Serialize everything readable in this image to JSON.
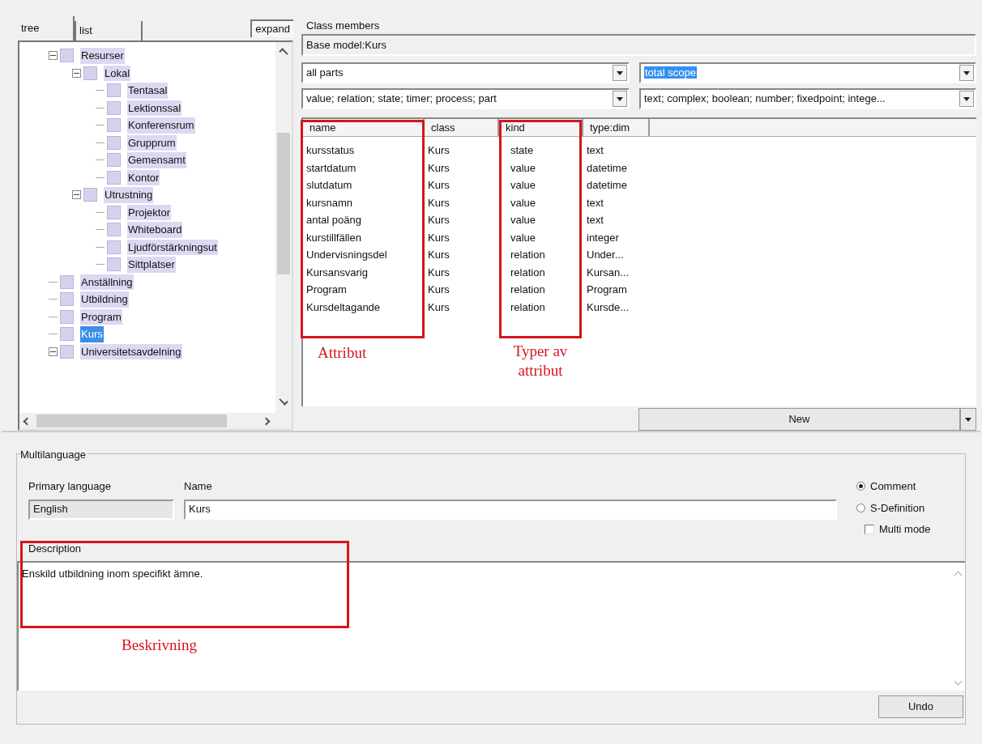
{
  "left_panel": {
    "tabs": [
      {
        "label": "tree",
        "selected": true
      },
      {
        "label": "list",
        "selected": false
      }
    ],
    "expand_button": "expand",
    "tree": [
      {
        "label": "Resurser",
        "selected": false,
        "expanded": true,
        "children": [
          {
            "label": "Lokal",
            "selected": false,
            "expanded": true,
            "children": [
              {
                "label": "Tentasal",
                "selected": false
              },
              {
                "label": "Lektionssal",
                "selected": false
              },
              {
                "label": "Konferensrum",
                "selected": false
              },
              {
                "label": "Grupprum",
                "selected": false
              },
              {
                "label": "Gemensamt",
                "selected": false
              },
              {
                "label": "Kontor",
                "selected": false
              }
            ]
          },
          {
            "label": "Utrustning",
            "selected": false,
            "expanded": true,
            "children": [
              {
                "label": "Projektor",
                "selected": false
              },
              {
                "label": "Whiteboard",
                "selected": false
              },
              {
                "label": "Ljudförstärkningsut",
                "selected": false
              },
              {
                "label": "Sittplatser",
                "selected": false
              }
            ]
          }
        ]
      },
      {
        "label": "Anställning",
        "selected": false
      },
      {
        "label": "Utbildning",
        "selected": false
      },
      {
        "label": "Program",
        "selected": false
      },
      {
        "label": "Kurs",
        "selected": true
      },
      {
        "label": "Universitetsavdelning",
        "selected": false,
        "expanded": true
      }
    ]
  },
  "class_members": {
    "title": "Class members",
    "base_model": "Base model:Kurs",
    "filters": [
      {
        "value": "all parts",
        "text_selected": false
      },
      {
        "value": "total scope",
        "text_selected": true
      },
      {
        "value": "value; relation; state; timer; process; part",
        "text_selected": false
      },
      {
        "value": "text; complex; boolean; number; fixedpoint; intege...",
        "text_selected": false
      }
    ],
    "table": {
      "columns": [
        "name",
        "class",
        "kind",
        "type:dim"
      ],
      "rows": [
        [
          "kursstatus",
          "Kurs",
          "state",
          "text"
        ],
        [
          "startdatum",
          "Kurs",
          "value",
          "datetime"
        ],
        [
          "slutdatum",
          "Kurs",
          "value",
          "datetime"
        ],
        [
          "kursnamn",
          "Kurs",
          "value",
          "text"
        ],
        [
          "antal poäng",
          "Kurs",
          "value",
          "text"
        ],
        [
          "kurstillfällen",
          "Kurs",
          "value",
          "integer"
        ],
        [
          "Undervisningsdel",
          "Kurs",
          "relation",
          "Under..."
        ],
        [
          "Kursansvarig",
          "Kurs",
          "relation",
          "Kursan..."
        ],
        [
          "Program",
          "Kurs",
          "relation",
          "Program"
        ],
        [
          "Kursdeltagande",
          "Kurs",
          "relation",
          "Kursde..."
        ]
      ]
    },
    "new_button": "New"
  },
  "multilanguage": {
    "title": "Multilanguage",
    "primary_language_label": "Primary language",
    "primary_language": "English",
    "name_label": "Name",
    "name": "Kurs",
    "options": [
      {
        "kind": "radio",
        "label": "Comment",
        "checked": true
      },
      {
        "kind": "radio",
        "label": "S-Definition",
        "checked": false
      },
      {
        "kind": "checkbox",
        "label": "Multi mode",
        "checked": false
      }
    ],
    "description_label": "Description",
    "description": "Enskild utbildning inom specifikt ämne.",
    "undo_button": "Undo"
  },
  "annotations": [
    {
      "label": "Attribut"
    },
    {
      "label": "Typer av attribut"
    },
    {
      "label": "Beskrivning"
    }
  ]
}
